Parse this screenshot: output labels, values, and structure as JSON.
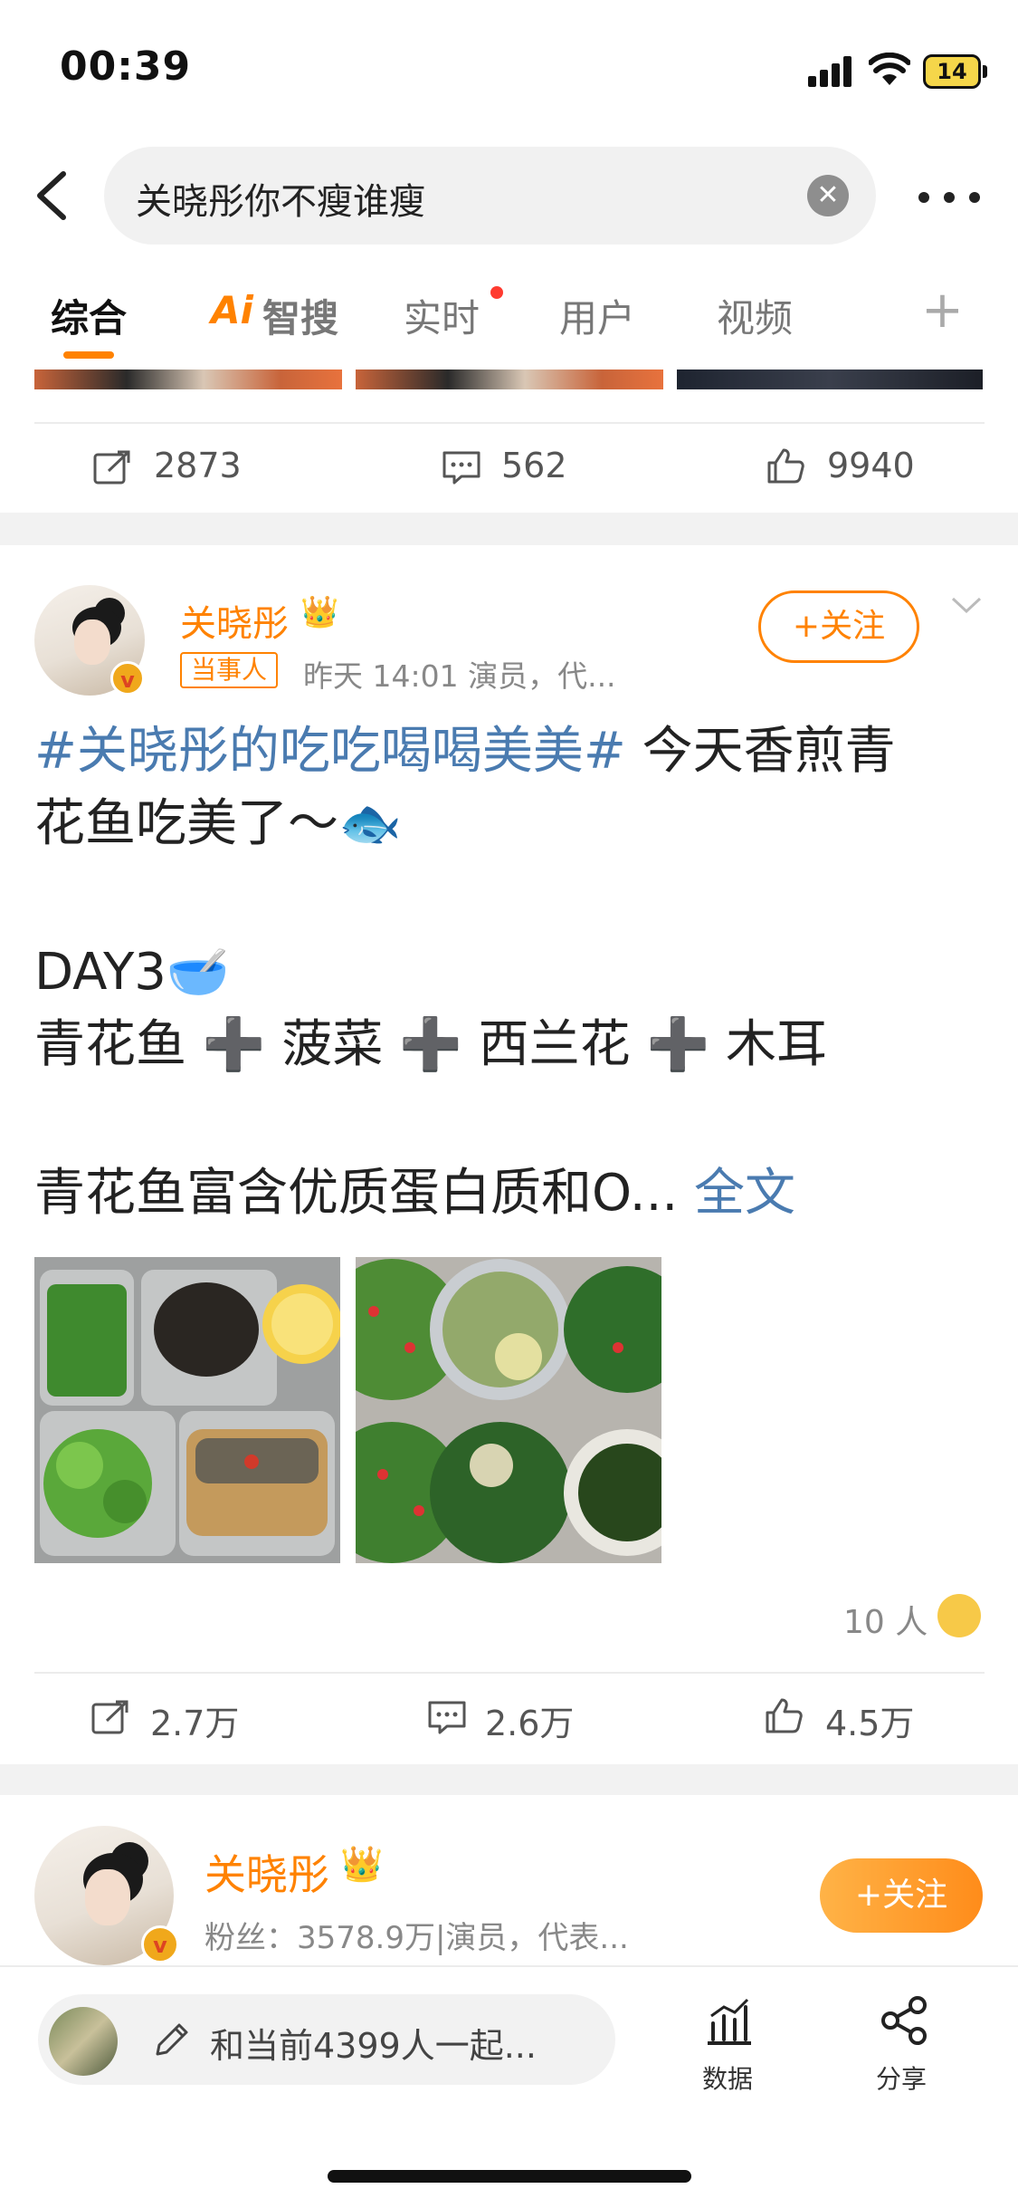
{
  "status": {
    "time": "00:39",
    "battery": "14"
  },
  "search": {
    "query": "关晓彤你不瘦谁瘦"
  },
  "tabs": [
    "综合",
    "Ai",
    "智搜",
    "实时",
    "用户",
    "视频",
    "+"
  ],
  "prev_post": {
    "reposts": "2873",
    "comments": "562",
    "likes": "9940"
  },
  "post": {
    "username": "关晓彤",
    "badge": "当事人",
    "meta": "昨天 14:01  演员，代...",
    "follow_label": "+关注",
    "hashtag": "#关晓彤的吃吃喝喝美美#",
    "line1_rest": " 今天香煎青",
    "line2": "花鱼吃美了～🐟",
    "line3": "DAY3🥣",
    "line4": "青花鱼 ➕ 菠菜 ➕ 西兰花 ➕ 木耳",
    "line5": "青花鱼富含优质蛋白质和O...",
    "more_link": " 全文",
    "likers": "10 人",
    "reposts": "2.7万",
    "comments": "2.6万",
    "likes": "4.5万"
  },
  "user_card": {
    "username": "关晓彤",
    "info": "粉丝：3578.9万|演员，代表...",
    "follow_label": "+关注"
  },
  "bottom": {
    "compose_placeholder": "和当前4399人一起...",
    "data_label": "数据",
    "share_label": "分享"
  },
  "colors": {
    "accent": "#ff8200",
    "link": "#4a7bb0"
  }
}
